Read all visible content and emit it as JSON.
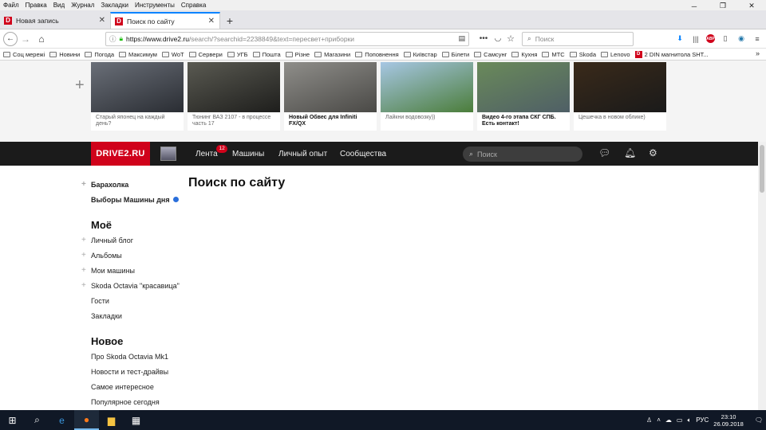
{
  "menu": [
    "Файл",
    "Правка",
    "Вид",
    "Журнал",
    "Закладки",
    "Инструменты",
    "Справка"
  ],
  "tabs": [
    {
      "title": "Новая запись",
      "favicon": "D"
    },
    {
      "title": "Поиск по сайту",
      "favicon": "D"
    }
  ],
  "address": {
    "domain": "https://www.drive2.ru",
    "path": "/search/?searchid=2238849&text=пересвет+приборки"
  },
  "browser_search": {
    "placeholder": "Поиск"
  },
  "bookmarks": [
    "Соц мережі",
    "Новини",
    "Погода",
    "Максимум",
    "WoT",
    "Сервери",
    "УГБ",
    "Пошта",
    "Різне",
    "Магазини",
    "Поповнення",
    "Київстар",
    "Білети",
    "Самсунг",
    "Кухня",
    "МТС",
    "Skoda",
    "Lenovo"
  ],
  "bookmark_page": {
    "favicon": "D",
    "label": "2 DIN магнитола SHT..."
  },
  "feed": [
    {
      "caption": "Старый японец на каждый день?",
      "bold": false,
      "colors": [
        "#6a6f78",
        "#2a2d33"
      ]
    },
    {
      "caption": "Тюнинг ВАЗ 2107 - в процессе часть 17",
      "bold": false,
      "colors": [
        "#5a5a52",
        "#1e1e1c"
      ]
    },
    {
      "caption": "Новый Обвес для Infiniti FX/QX",
      "bold": true,
      "colors": [
        "#8f8e8a",
        "#4a4946"
      ]
    },
    {
      "caption": "Лайкни водовозку))",
      "bold": false,
      "colors": [
        "#a7c7e4",
        "#4b7d3a"
      ]
    },
    {
      "caption": "Видео 4-го этапа СКГ СПБ. Есть контакт!",
      "bold": true,
      "colors": [
        "#6a8a5a",
        "#4f5f66"
      ]
    },
    {
      "caption": "Цешечка в новом облике)",
      "bold": false,
      "colors": [
        "#3a2a1a",
        "#1a1a1a"
      ]
    }
  ],
  "site": {
    "logo": "DRIVE2.RU",
    "nav": [
      {
        "label": "Лента",
        "badge": "12"
      },
      {
        "label": "Машины"
      },
      {
        "label": "Личный опыт"
      },
      {
        "label": "Сообщества"
      }
    ],
    "search_placeholder": "Поиск"
  },
  "page_title": "Поиск по сайту",
  "sidebar": {
    "top": [
      {
        "label": "Барахолка",
        "plus": true,
        "bold": true
      },
      {
        "label": "Выборы Машины дня",
        "plus": false,
        "bold": true,
        "dot": true
      }
    ],
    "mine_title": "Моё",
    "mine": [
      {
        "label": "Личный блог",
        "plus": true
      },
      {
        "label": "Альбомы",
        "plus": true
      },
      {
        "label": "Мои машины",
        "plus": true
      },
      {
        "label": "Skoda Octavia \"красавица\"",
        "plus": true
      },
      {
        "label": "Гости",
        "plus": false
      },
      {
        "label": "Закладки",
        "plus": false
      }
    ],
    "new_title": "Новое",
    "new": [
      {
        "label": "Про Skoda Octavia Mk1"
      },
      {
        "label": "Новости и тест-драйвы"
      },
      {
        "label": "Самое интересное"
      },
      {
        "label": "Популярное сегодня"
      }
    ]
  },
  "taskbar": {
    "lang": "РУС",
    "time": "23:10",
    "date": "26.09.2018"
  },
  "colors": {
    "accent": "#d0021b",
    "nav_bg": "#1b1b1b",
    "dot": "#2a6fdb"
  }
}
